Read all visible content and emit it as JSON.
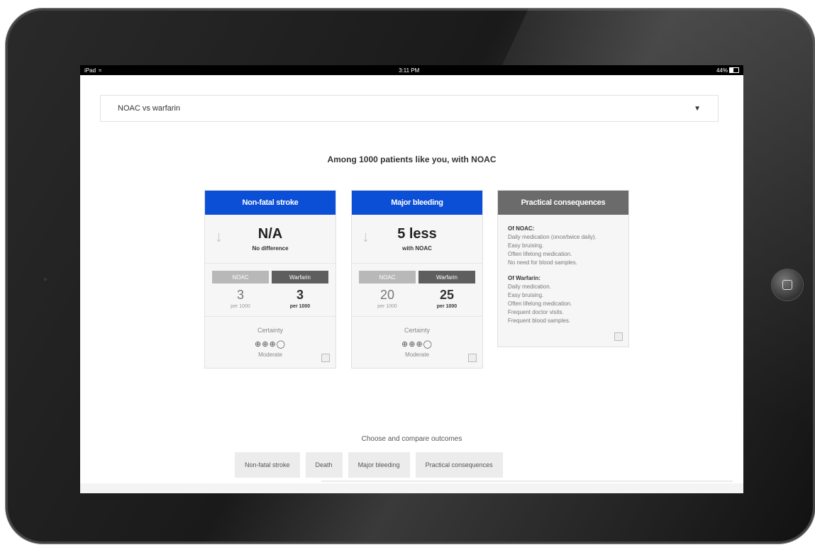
{
  "statusbar": {
    "device": "iPad",
    "time": "3:11 PM",
    "battery": "44%"
  },
  "dropdown": {
    "selected": "NOAC vs warfarin",
    "arrow": "▼"
  },
  "headline": "Among 1000 patients like you, with NOAC",
  "cards": [
    {
      "title": "Non-fatal stroke",
      "effect_main": "N/A",
      "effect_sub": "No difference",
      "left_tag": "NOAC",
      "right_tag": "Warfarin",
      "left_value": "3",
      "left_unit": "per 1000",
      "right_value": "3",
      "right_unit": "per 1000",
      "certainty_label": "Certainty",
      "certainty_circles": "⊕⊕⊕◯",
      "certainty_rating": "Moderate"
    },
    {
      "title": "Major bleeding",
      "effect_main": "5 less",
      "effect_sub": "with NOAC",
      "left_tag": "NOAC",
      "right_tag": "Warfarin",
      "left_value": "20",
      "left_unit": "per 1000",
      "right_value": "25",
      "right_unit": "per 1000",
      "certainty_label": "Certainty",
      "certainty_circles": "⊕⊕⊕◯",
      "certainty_rating": "Moderate"
    }
  ],
  "practical": {
    "title": "Practical consequences",
    "noac_heading": "Of NOAC:",
    "noac_items": [
      "Daily medication (once/twice daily).",
      "Easy bruising.",
      "Often lifelong medication.",
      "No need for blood samples."
    ],
    "warfarin_heading": "Of Warfarin:",
    "warfarin_items": [
      "Daily medication.",
      "Easy bruising.",
      "Often lifelong medication.",
      "Frequent doctor visits.",
      "Frequent blood samples."
    ]
  },
  "compare": {
    "title": "Choose and compare outcomes",
    "chips": [
      "Non-fatal stroke",
      "Death",
      "Major bleeding",
      "Practical consequences"
    ]
  },
  "colors": {
    "accent_blue": "#0a4fd6",
    "header_grey": "#6b6b6b"
  }
}
